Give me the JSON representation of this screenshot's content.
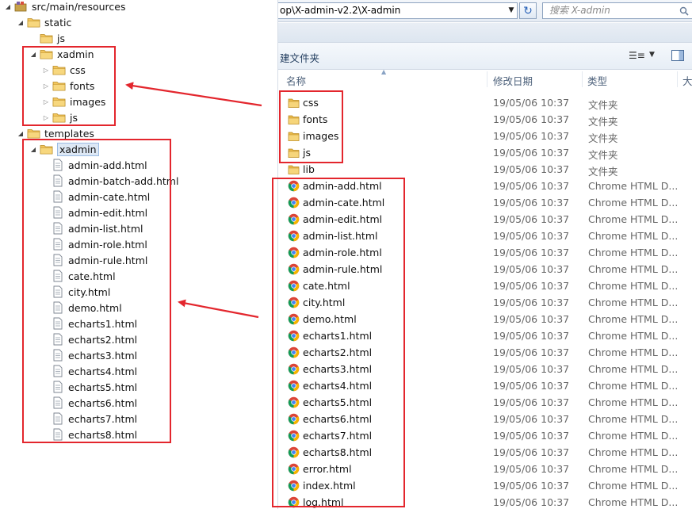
{
  "tree": {
    "nodes": [
      {
        "label": "src/main/resources",
        "kind": "package",
        "arrow": "open"
      },
      {
        "label": "static",
        "kind": "folder",
        "arrow": "open"
      },
      {
        "label": "js",
        "kind": "folder",
        "arrow": "none"
      },
      {
        "label": "xadmin",
        "kind": "folder",
        "arrow": "open"
      },
      {
        "label": "css",
        "kind": "folder",
        "arrow": "closed"
      },
      {
        "label": "fonts",
        "kind": "folder",
        "arrow": "closed"
      },
      {
        "label": "images",
        "kind": "folder",
        "arrow": "closed"
      },
      {
        "label": "js",
        "kind": "folder",
        "arrow": "closed"
      },
      {
        "label": "templates",
        "kind": "folder",
        "arrow": "open"
      },
      {
        "label": "xadmin",
        "kind": "folder",
        "arrow": "open",
        "selected": true
      },
      {
        "label": "admin-add.html",
        "kind": "file",
        "arrow": "none"
      },
      {
        "label": "admin-batch-add.html",
        "kind": "file",
        "arrow": "none"
      },
      {
        "label": "admin-cate.html",
        "kind": "file",
        "arrow": "none"
      },
      {
        "label": "admin-edit.html",
        "kind": "file",
        "arrow": "none"
      },
      {
        "label": "admin-list.html",
        "kind": "file",
        "arrow": "none"
      },
      {
        "label": "admin-role.html",
        "kind": "file",
        "arrow": "none"
      },
      {
        "label": "admin-rule.html",
        "kind": "file",
        "arrow": "none"
      },
      {
        "label": "cate.html",
        "kind": "file",
        "arrow": "none"
      },
      {
        "label": "city.html",
        "kind": "file",
        "arrow": "none"
      },
      {
        "label": "demo.html",
        "kind": "file",
        "arrow": "none"
      },
      {
        "label": "echarts1.html",
        "kind": "file",
        "arrow": "none"
      },
      {
        "label": "echarts2.html",
        "kind": "file",
        "arrow": "none"
      },
      {
        "label": "echarts3.html",
        "kind": "file",
        "arrow": "none"
      },
      {
        "label": "echarts4.html",
        "kind": "file",
        "arrow": "none"
      },
      {
        "label": "echarts5.html",
        "kind": "file",
        "arrow": "none"
      },
      {
        "label": "echarts6.html",
        "kind": "file",
        "arrow": "none"
      },
      {
        "label": "echarts7.html",
        "kind": "file",
        "arrow": "none"
      },
      {
        "label": "echarts8.html",
        "kind": "file",
        "arrow": "none"
      }
    ]
  },
  "explorer": {
    "address": "op\\X-admin-v2.2\\X-admin",
    "search_placeholder": "搜索 X-admin",
    "new_folder": "建文件夹",
    "columns": {
      "name": "名称",
      "modified": "修改日期",
      "type": "类型",
      "size": "大"
    },
    "files": [
      {
        "name": "css",
        "date": "19/05/06 10:37",
        "type": "文件夹",
        "kind": "folder"
      },
      {
        "name": "fonts",
        "date": "19/05/06 10:37",
        "type": "文件夹",
        "kind": "folder"
      },
      {
        "name": "images",
        "date": "19/05/06 10:37",
        "type": "文件夹",
        "kind": "folder"
      },
      {
        "name": "js",
        "date": "19/05/06 10:37",
        "type": "文件夹",
        "kind": "folder"
      },
      {
        "name": "lib",
        "date": "19/05/06 10:37",
        "type": "文件夹",
        "kind": "folder"
      },
      {
        "name": "admin-add.html",
        "date": "19/05/06 10:37",
        "type": "Chrome HTML D...",
        "kind": "chrome"
      },
      {
        "name": "admin-cate.html",
        "date": "19/05/06 10:37",
        "type": "Chrome HTML D...",
        "kind": "chrome"
      },
      {
        "name": "admin-edit.html",
        "date": "19/05/06 10:37",
        "type": "Chrome HTML D...",
        "kind": "chrome"
      },
      {
        "name": "admin-list.html",
        "date": "19/05/06 10:37",
        "type": "Chrome HTML D...",
        "kind": "chrome"
      },
      {
        "name": "admin-role.html",
        "date": "19/05/06 10:37",
        "type": "Chrome HTML D...",
        "kind": "chrome"
      },
      {
        "name": "admin-rule.html",
        "date": "19/05/06 10:37",
        "type": "Chrome HTML D...",
        "kind": "chrome"
      },
      {
        "name": "cate.html",
        "date": "19/05/06 10:37",
        "type": "Chrome HTML D...",
        "kind": "chrome"
      },
      {
        "name": "city.html",
        "date": "19/05/06 10:37",
        "type": "Chrome HTML D...",
        "kind": "chrome"
      },
      {
        "name": "demo.html",
        "date": "19/05/06 10:37",
        "type": "Chrome HTML D...",
        "kind": "chrome"
      },
      {
        "name": "echarts1.html",
        "date": "19/05/06 10:37",
        "type": "Chrome HTML D...",
        "kind": "chrome"
      },
      {
        "name": "echarts2.html",
        "date": "19/05/06 10:37",
        "type": "Chrome HTML D...",
        "kind": "chrome"
      },
      {
        "name": "echarts3.html",
        "date": "19/05/06 10:37",
        "type": "Chrome HTML D...",
        "kind": "chrome"
      },
      {
        "name": "echarts4.html",
        "date": "19/05/06 10:37",
        "type": "Chrome HTML D...",
        "kind": "chrome"
      },
      {
        "name": "echarts5.html",
        "date": "19/05/06 10:37",
        "type": "Chrome HTML D...",
        "kind": "chrome"
      },
      {
        "name": "echarts6.html",
        "date": "19/05/06 10:37",
        "type": "Chrome HTML D...",
        "kind": "chrome"
      },
      {
        "name": "echarts7.html",
        "date": "19/05/06 10:37",
        "type": "Chrome HTML D...",
        "kind": "chrome"
      },
      {
        "name": "echarts8.html",
        "date": "19/05/06 10:37",
        "type": "Chrome HTML D...",
        "kind": "chrome"
      },
      {
        "name": "error.html",
        "date": "19/05/06 10:37",
        "type": "Chrome HTML D...",
        "kind": "chrome"
      },
      {
        "name": "index.html",
        "date": "19/05/06 10:37",
        "type": "Chrome HTML D...",
        "kind": "chrome"
      },
      {
        "name": "log.html",
        "date": "19/05/06 10:37",
        "type": "Chrome HTML D...",
        "kind": "chrome"
      }
    ]
  },
  "colors": {
    "highlight": "#e3262d",
    "folder": "#f2c55c",
    "selection": "#dde8f5"
  }
}
